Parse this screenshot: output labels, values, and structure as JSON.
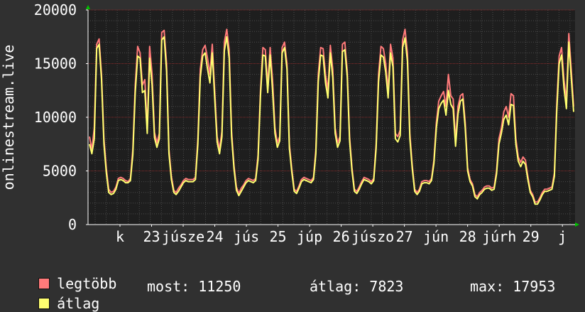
{
  "chart_data": {
    "type": "line",
    "ylabel": "onlinestream.live",
    "ylim": [
      0,
      20000
    ],
    "yticks": [
      0,
      5000,
      10000,
      15000,
      20000
    ],
    "yticklabels": [
      "0",
      "5000",
      "10000",
      "15000",
      "20000"
    ],
    "xticklabels": [
      "k",
      "23",
      "júsze",
      "24",
      "jús",
      "25",
      "júp",
      "26",
      "júszo",
      "27",
      "jún",
      "28",
      "júrh",
      "29",
      "j"
    ],
    "grid": true,
    "legend_placement": "bottom-left",
    "series": [
      {
        "name": "legtöbb",
        "color": "#ff7a7a",
        "values": [
          8200,
          7000,
          9000,
          16800,
          17300,
          14000,
          8000,
          5200,
          3300,
          3000,
          3100,
          3500,
          4300,
          4400,
          4300,
          4100,
          4000,
          4300,
          7000,
          13000,
          16600,
          16000,
          13000,
          13500,
          9000,
          16600,
          14000,
          8600,
          7600,
          8500,
          17900,
          18100,
          15000,
          7000,
          4500,
          3200,
          3000,
          3400,
          3700,
          4100,
          4300,
          4200,
          4200,
          4200,
          4400,
          8000,
          14500,
          16300,
          16700,
          15500,
          14000,
          16800,
          12500,
          8200,
          7000,
          8700,
          17000,
          18200,
          16300,
          8700,
          5500,
          3500,
          2900,
          3400,
          3700,
          4100,
          4300,
          4200,
          4100,
          4300,
          6500,
          12500,
          16500,
          16300,
          13000,
          16500,
          13500,
          9000,
          7600,
          8200,
          16500,
          17000,
          15000,
          7500,
          5200,
          3300,
          3100,
          3600,
          4200,
          4400,
          4300,
          4200,
          4100,
          4400,
          7000,
          14000,
          16500,
          16400,
          14000,
          12500,
          16700,
          14500,
          9000,
          7600,
          8200,
          16800,
          17000,
          14300,
          8200,
          5300,
          3300,
          3100,
          3500,
          4000,
          4400,
          4300,
          4200,
          4000,
          4300,
          7500,
          14000,
          16600,
          16400,
          15000,
          12500,
          16800,
          15500,
          8500,
          8200,
          8800,
          17200,
          18200,
          16000,
          8500,
          5500,
          3300,
          3000,
          3300,
          4000,
          4100,
          4100,
          4000,
          4300,
          6000,
          9500,
          11500,
          12000,
          12400,
          11000,
          14000,
          12000,
          11700,
          7800,
          11000,
          12000,
          12200,
          9500,
          5300,
          4200,
          3800,
          2800,
          2600,
          3000,
          3200,
          3500,
          3600,
          3600,
          3400,
          3500,
          5000,
          8000,
          9000,
          10500,
          11000,
          10000,
          12200,
          12000,
          8000,
          6300,
          5800,
          6300,
          6000,
          4500,
          3200,
          2800,
          2100,
          2100,
          2500,
          3000,
          3300,
          3300,
          3400,
          3500,
          4800,
          11200,
          15700,
          16500,
          13500,
          11500,
          17800,
          14500,
          11000
        ]
      },
      {
        "name": "átlag",
        "color": "#ffff70",
        "values": [
          7500,
          6600,
          8000,
          16400,
          16800,
          13500,
          7500,
          4800,
          3000,
          2800,
          2900,
          3300,
          4100,
          4200,
          4100,
          3900,
          3900,
          4100,
          6500,
          12300,
          15700,
          15500,
          12300,
          12500,
          8500,
          15500,
          13000,
          8100,
          7200,
          8000,
          17200,
          17500,
          14300,
          6600,
          4200,
          3000,
          2800,
          3100,
          3500,
          3900,
          4100,
          4000,
          4000,
          4000,
          4200,
          7500,
          13700,
          15700,
          16000,
          14500,
          13200,
          16000,
          11800,
          7700,
          6600,
          8200,
          16200,
          17500,
          15500,
          8200,
          5200,
          3200,
          2700,
          3100,
          3500,
          3900,
          4100,
          4000,
          3900,
          4100,
          6100,
          12000,
          15800,
          15700,
          12300,
          15800,
          12500,
          8500,
          7200,
          7800,
          16000,
          16500,
          14500,
          7100,
          4900,
          3100,
          2900,
          3400,
          4000,
          4200,
          4100,
          4000,
          3900,
          4200,
          6600,
          13300,
          15800,
          15700,
          13200,
          11800,
          16000,
          13700,
          8500,
          7200,
          7800,
          16100,
          16300,
          13800,
          7800,
          5000,
          3100,
          2900,
          3300,
          3800,
          4200,
          4100,
          4000,
          3800,
          4100,
          7100,
          13300,
          15800,
          15600,
          14200,
          11800,
          16000,
          14700,
          8000,
          7700,
          8300,
          16500,
          17400,
          15200,
          8000,
          5200,
          3100,
          2800,
          3100,
          3800,
          3900,
          3900,
          3800,
          4100,
          5700,
          9000,
          10800,
          11300,
          11600,
          10200,
          12500,
          11200,
          10800,
          7300,
          10300,
          11500,
          11700,
          9000,
          5000,
          4000,
          3600,
          2600,
          2400,
          2800,
          3000,
          3300,
          3400,
          3400,
          3200,
          3300,
          4700,
          7500,
          8500,
          9800,
          10200,
          9300,
          11200,
          11100,
          7500,
          5900,
          5400,
          5900,
          5600,
          4200,
          3000,
          2600,
          1900,
          1900,
          2300,
          2800,
          3100,
          3100,
          3200,
          3300,
          4500,
          10500,
          15000,
          15800,
          12700,
          10800,
          17000,
          13700,
          10500
        ]
      }
    ]
  },
  "legend": {
    "max_label": "legtöbb",
    "avg_label": "átlag",
    "current": "most: 11250",
    "average": "átlag: 7823",
    "maximum": "max: 17953"
  },
  "colors": {
    "background": "#303030",
    "plot_background": "#1e1e1e",
    "grid_major": "#8a2a2a",
    "axis_arrow": "#00c000"
  }
}
